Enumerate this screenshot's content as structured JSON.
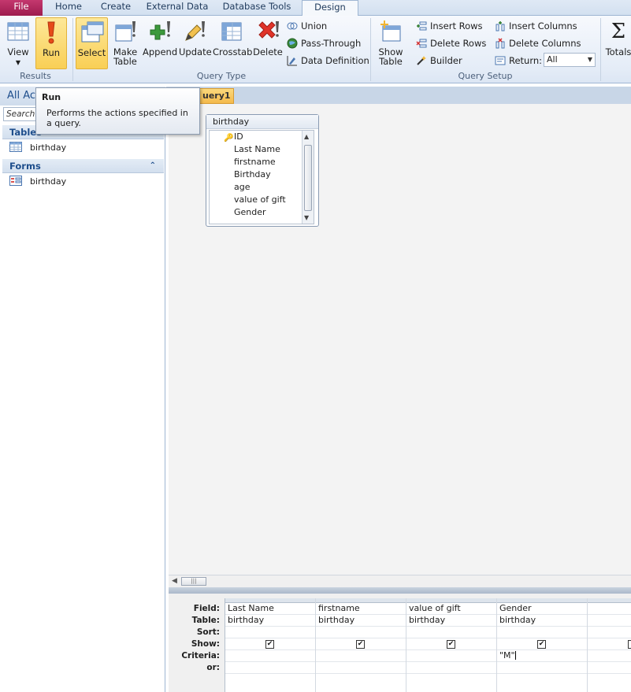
{
  "tabs": [
    {
      "label": "File"
    },
    {
      "label": "Home"
    },
    {
      "label": "Create"
    },
    {
      "label": "External Data"
    },
    {
      "label": "Database Tools"
    },
    {
      "label": "Design"
    }
  ],
  "ribbon": {
    "results": {
      "label": "Results",
      "view": "View",
      "run": "Run"
    },
    "query_type": {
      "label": "Query Type",
      "select": "Select",
      "make_table_1": "Make",
      "make_table_2": "Table",
      "append": "Append",
      "update": "Update",
      "crosstab": "Crosstab",
      "delete": "Delete",
      "union": "Union",
      "pass_through": "Pass-Through",
      "data_definition": "Data Definition"
    },
    "query_setup": {
      "label": "Query Setup",
      "show_table_1": "Show",
      "show_table_2": "Table",
      "insert_rows": "Insert Rows",
      "delete_rows": "Delete Rows",
      "builder": "Builder",
      "insert_columns": "Insert Columns",
      "delete_columns": "Delete Columns",
      "return_label": "Return:",
      "return_value": "All"
    },
    "totals": "Totals"
  },
  "tooltip": {
    "title": "Run",
    "body": "Performs the actions specified in a query."
  },
  "nav": {
    "header": "All Acc",
    "search_placeholder": "Search...",
    "tables_label": "Tables",
    "tables": [
      {
        "label": "birthday"
      }
    ],
    "forms_label": "Forms",
    "forms": [
      {
        "label": "birthday"
      }
    ]
  },
  "document": {
    "tab_label": "uery1"
  },
  "field_list": {
    "title": "birthday",
    "fields": [
      "ID",
      "Last Name",
      "firstname",
      "Birthday",
      "age",
      "value of gift",
      "Gender"
    ]
  },
  "grid": {
    "row_labels": [
      "Field:",
      "Table:",
      "Sort:",
      "Show:",
      "Criteria:",
      "or:"
    ],
    "columns": [
      {
        "field": "Last Name",
        "table": "birthday",
        "show": true,
        "criteria": ""
      },
      {
        "field": "firstname",
        "table": "birthday",
        "show": true,
        "criteria": ""
      },
      {
        "field": "value of gift",
        "table": "birthday",
        "show": true,
        "criteria": ""
      },
      {
        "field": "Gender",
        "table": "birthday",
        "show": true,
        "criteria": "\"M\""
      }
    ],
    "check_mark": "✔"
  }
}
